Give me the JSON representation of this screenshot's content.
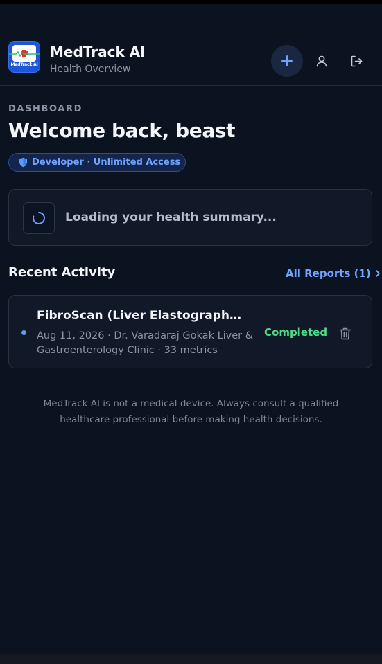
{
  "header": {
    "app_title": "MedTrack AI",
    "app_subtitle": "Health Overview",
    "logo_text": "MedTrack AI",
    "icons": {
      "add": "plus-icon",
      "profile": "user-icon",
      "logout": "logout-icon"
    }
  },
  "dashboard": {
    "section_label": "DASHBOARD",
    "welcome": "Welcome back, beast",
    "badge": {
      "text": "Developer · Unlimited Access",
      "icon": "shield-icon"
    },
    "loading_text": "Loading your health summary..."
  },
  "recent_activity": {
    "title": "Recent Activity",
    "all_reports_label": "All Reports (1)",
    "reports": [
      {
        "title": "FibroScan (Liver Elastography) R...",
        "meta": "Aug 11, 2026 · Dr. Varadaraj Gokak Liver & Gastroenterology Clinic · 33 metrics",
        "status": "Completed"
      }
    ]
  },
  "disclaimer": "MedTrack AI is not a medical device. Always consult a qualified healthcare professional before making health decisions.",
  "colors": {
    "background": "#0b1220",
    "accent": "#6ea3ff",
    "status_completed": "#4ddb88"
  }
}
